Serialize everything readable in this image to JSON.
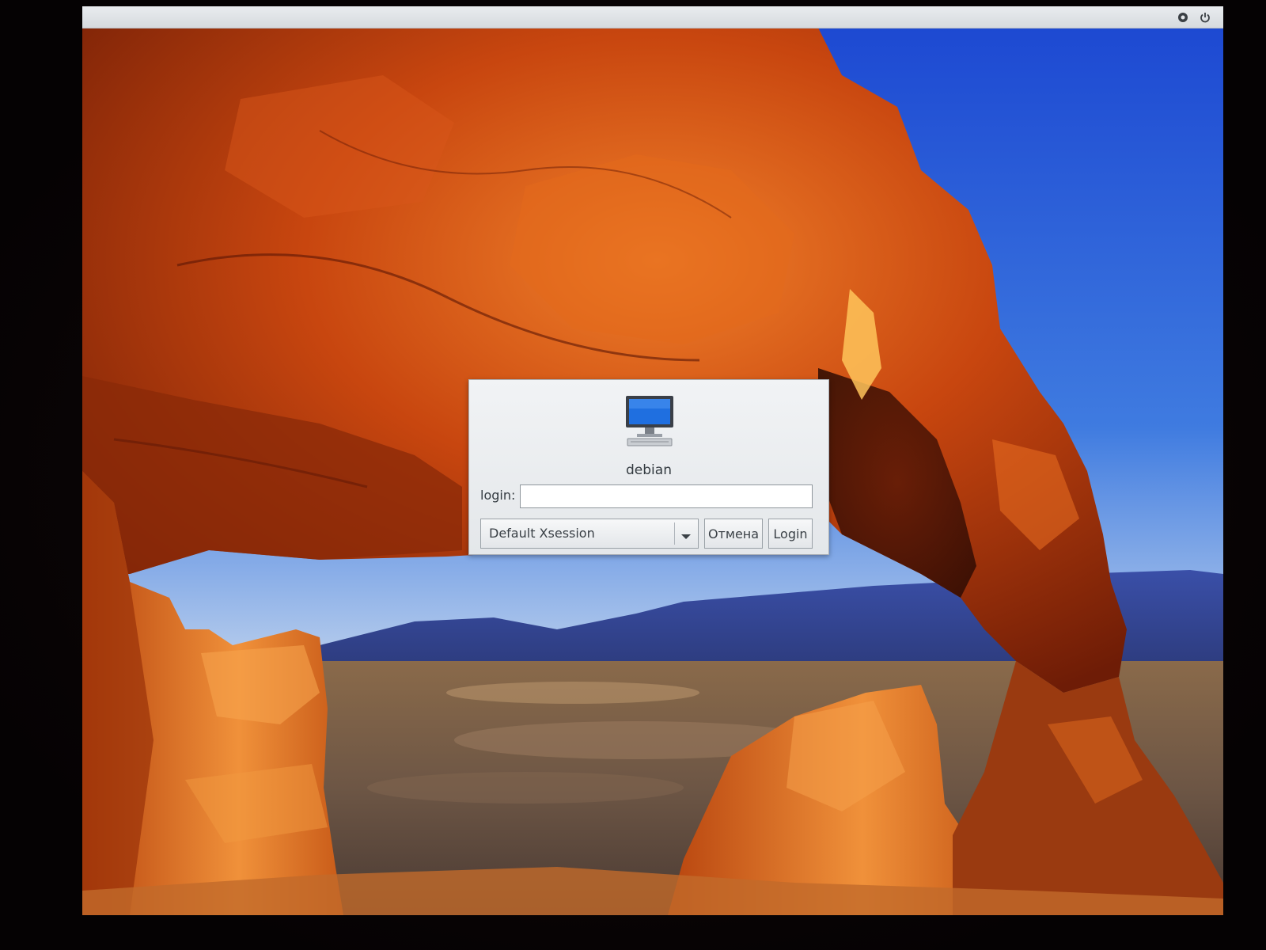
{
  "panel": {
    "icons": [
      "settings-icon",
      "power-icon"
    ]
  },
  "wallpaper": {
    "description_colors": {
      "sky_top": "#1f4fd6",
      "sky_bottom": "#e8ecf2",
      "rock": "#c2480f",
      "rock_highlight": "#f08a2a"
    }
  },
  "dialog": {
    "host_icon": "computer-icon",
    "hostname": "debian",
    "login_label": "login:",
    "login_value": "",
    "session_value": "Default Xsession",
    "cancel_label": "Отмена",
    "login_button_label": "Login"
  }
}
